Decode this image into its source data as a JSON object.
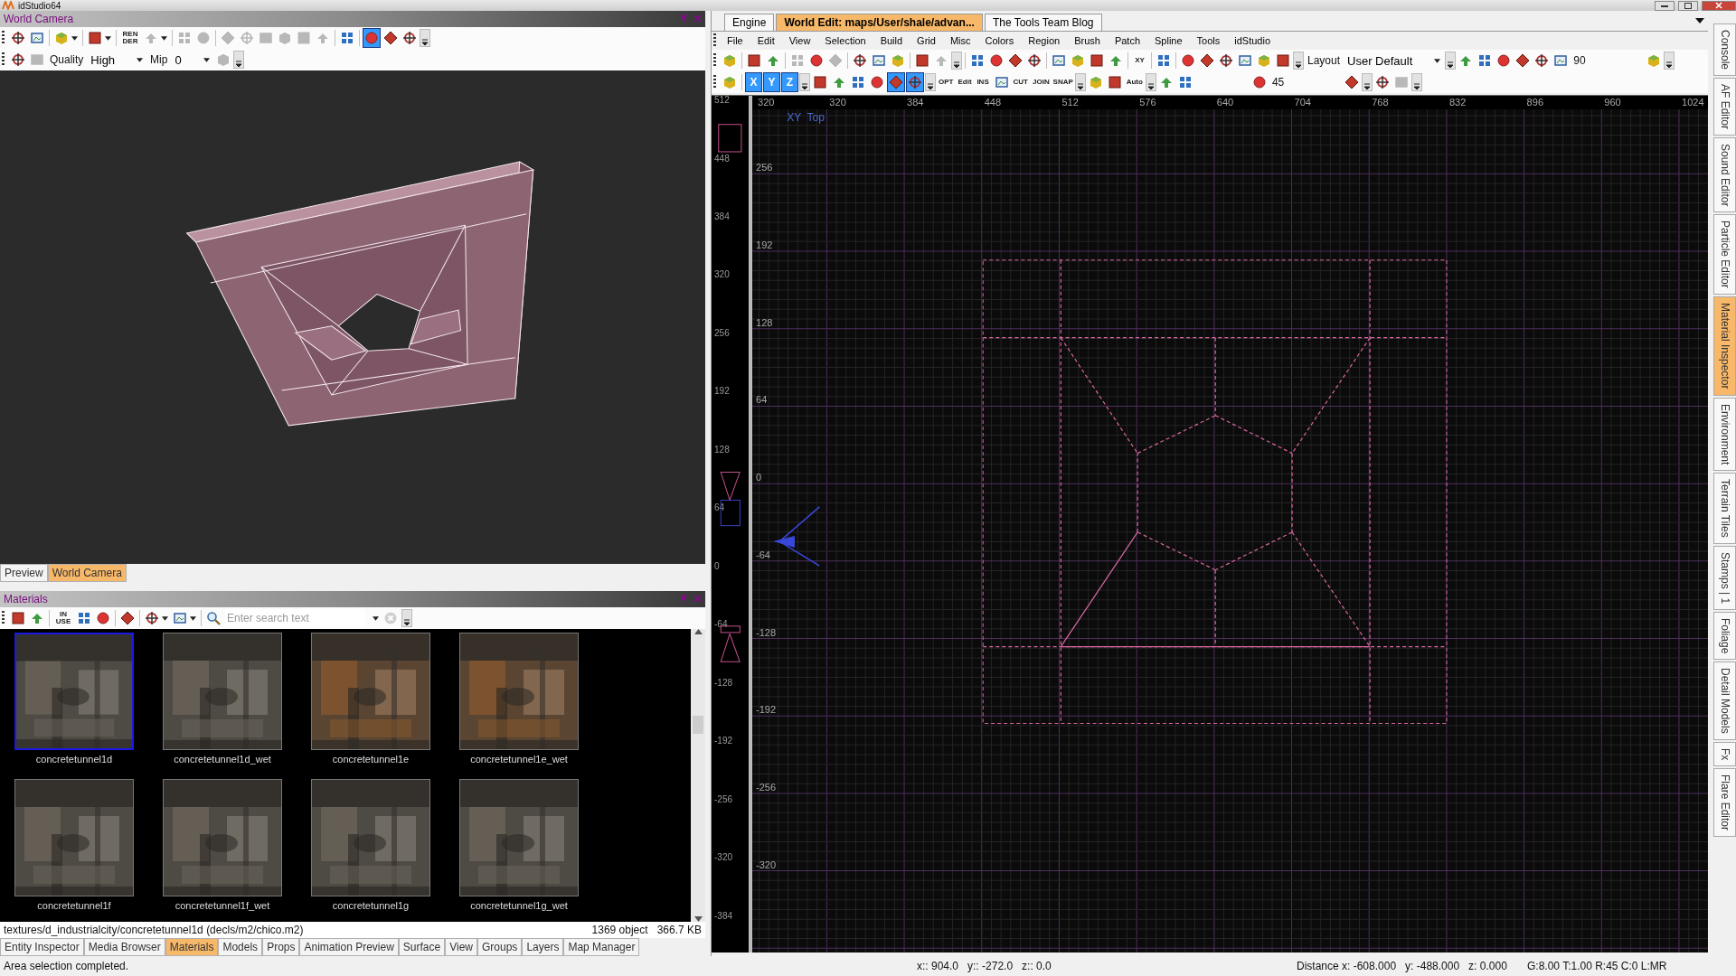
{
  "app_title": "idStudio64",
  "world_camera": {
    "title": "World Camera",
    "toolbar_1": [
      {
        "kind": "icon",
        "selected": false,
        "disabled": false
      },
      {
        "kind": "icon",
        "selected": false,
        "disabled": false
      },
      {
        "kind": "separator"
      },
      {
        "kind": "menu-icon",
        "selected": false,
        "disabled": false
      },
      {
        "kind": "separator"
      },
      {
        "kind": "menu-icon",
        "selected": false,
        "disabled": false
      },
      {
        "kind": "separator"
      },
      {
        "kind": "label-icon",
        "label": "REN DER",
        "selected": false,
        "disabled": false
      },
      {
        "kind": "menu-icon",
        "selected": false,
        "disabled": true
      },
      {
        "kind": "separator"
      },
      {
        "kind": "icon",
        "selected": false,
        "disabled": true
      },
      {
        "kind": "icon",
        "selected": false,
        "disabled": true
      },
      {
        "kind": "separator"
      },
      {
        "kind": "icon",
        "selected": false,
        "disabled": true
      },
      {
        "kind": "icon",
        "selected": false,
        "disabled": true
      },
      {
        "kind": "icon",
        "selected": false,
        "disabled": true
      },
      {
        "kind": "icon",
        "selected": false,
        "disabled": true
      },
      {
        "kind": "icon",
        "selected": false,
        "disabled": true
      },
      {
        "kind": "icon",
        "selected": false,
        "disabled": true
      },
      {
        "kind": "separator"
      },
      {
        "kind": "icon",
        "selected": false,
        "disabled": false
      },
      {
        "kind": "separator"
      },
      {
        "kind": "icon",
        "selected": true,
        "disabled": false
      },
      {
        "kind": "icon",
        "selected": false,
        "disabled": false
      },
      {
        "kind": "icon",
        "selected": false,
        "disabled": false
      },
      {
        "kind": "overflow"
      }
    ],
    "toolbar_2": [
      {
        "kind": "icon",
        "selected": false,
        "disabled": false
      },
      {
        "kind": "icon",
        "selected": false,
        "disabled": true
      },
      {
        "kind": "text",
        "label": "Quality"
      },
      {
        "kind": "dropdown",
        "value": "High"
      },
      {
        "kind": "text",
        "label": "Mip"
      },
      {
        "kind": "dropdown",
        "value": "0"
      },
      {
        "kind": "icon",
        "selected": false,
        "disabled": true
      },
      {
        "kind": "overflow"
      }
    ],
    "tabs": [
      {
        "label": "Preview",
        "selected": false
      },
      {
        "label": "World Camera",
        "selected": true
      }
    ]
  },
  "materials": {
    "title": "Materials",
    "toolbar": [
      {
        "kind": "icon",
        "selected": false,
        "disabled": false
      },
      {
        "kind": "icon",
        "selected": false,
        "disabled": false
      },
      {
        "kind": "separator"
      },
      {
        "kind": "label-icon",
        "label": "IN USE",
        "selected": false,
        "disabled": false
      },
      {
        "kind": "icon",
        "selected": false,
        "disabled": false
      },
      {
        "kind": "icon",
        "selected": false,
        "disabled": false
      },
      {
        "kind": "separator"
      },
      {
        "kind": "icon",
        "selected": false,
        "disabled": false
      },
      {
        "kind": "separator"
      },
      {
        "kind": "menu-icon",
        "selected": false,
        "disabled": false
      },
      {
        "kind": "menu-icon",
        "selected": false,
        "disabled": false
      },
      {
        "kind": "separator"
      },
      {
        "kind": "search",
        "placeholder": "Enter search text"
      },
      {
        "kind": "overflow"
      }
    ],
    "items": [
      {
        "name": "concretetunnel1d",
        "selected": true
      },
      {
        "name": "concretetunnel1d_wet",
        "selected": false
      },
      {
        "name": "concretetunnel1e",
        "selected": false
      },
      {
        "name": "concretetunnel1e_wet",
        "selected": false
      },
      {
        "name": "concretetunnel1f",
        "selected": false
      },
      {
        "name": "concretetunnel1f_wet",
        "selected": false
      },
      {
        "name": "concretetunnel1g",
        "selected": false
      },
      {
        "name": "concretetunnel1g_wet",
        "selected": false
      }
    ],
    "path": "textures/d_industrialcity/concretetunnel1d  (decls/m2/chico.m2)",
    "object_count": "1369 object",
    "size": "366.7 KB"
  },
  "bottom_tabs": [
    {
      "label": "Entity Inspector",
      "selected": false
    },
    {
      "label": "Media Browser",
      "selected": false
    },
    {
      "label": "Materials",
      "selected": true
    },
    {
      "label": "Models",
      "selected": false
    },
    {
      "label": "Props",
      "selected": false
    },
    {
      "label": "Animation Preview",
      "selected": false
    },
    {
      "label": "Surface",
      "selected": false
    },
    {
      "label": "View",
      "selected": false
    },
    {
      "label": "Groups",
      "selected": false
    },
    {
      "label": "Layers",
      "selected": false
    },
    {
      "label": "Map Manager",
      "selected": false
    }
  ],
  "editor": {
    "tabs": [
      {
        "label": "Engine",
        "selected": false
      },
      {
        "label": "World Edit: maps/User/shale/advan...",
        "selected": true
      },
      {
        "label": "The Tools Team Blog",
        "selected": false
      }
    ],
    "menu": [
      "File",
      "Edit",
      "View",
      "Selection",
      "Build",
      "Grid",
      "Misc",
      "Colors",
      "Region",
      "Brush",
      "Patch",
      "Spline",
      "Tools",
      "idStudio"
    ],
    "toolbar_1": [
      {
        "kind": "icon",
        "selected": false,
        "disabled": false
      },
      {
        "kind": "separator"
      },
      {
        "kind": "icon",
        "selected": false,
        "disabled": false
      },
      {
        "kind": "icon",
        "selected": false,
        "disabled": false
      },
      {
        "kind": "separator"
      },
      {
        "kind": "icon",
        "selected": false,
        "disabled": true
      },
      {
        "kind": "icon",
        "selected": false,
        "disabled": false
      },
      {
        "kind": "icon",
        "selected": false,
        "disabled": true
      },
      {
        "kind": "separator"
      },
      {
        "kind": "icon",
        "selected": false,
        "disabled": false
      },
      {
        "kind": "icon",
        "selected": false,
        "disabled": false
      },
      {
        "kind": "icon",
        "selected": false,
        "disabled": false
      },
      {
        "kind": "separator"
      },
      {
        "kind": "icon",
        "selected": false,
        "disabled": false
      },
      {
        "kind": "icon",
        "selected": false,
        "disabled": true
      },
      {
        "kind": "overflow"
      },
      {
        "kind": "separator"
      },
      {
        "kind": "icon",
        "selected": false,
        "disabled": false
      },
      {
        "kind": "icon",
        "selected": false,
        "disabled": false
      },
      {
        "kind": "icon",
        "selected": false,
        "disabled": false
      },
      {
        "kind": "icon",
        "selected": false,
        "disabled": false
      },
      {
        "kind": "separator"
      },
      {
        "kind": "icon",
        "selected": false,
        "disabled": false
      },
      {
        "kind": "icon",
        "selected": false,
        "disabled": false
      },
      {
        "kind": "icon",
        "selected": false,
        "disabled": false
      },
      {
        "kind": "icon",
        "selected": false,
        "disabled": false
      },
      {
        "kind": "separator"
      },
      {
        "kind": "label-icon",
        "label": "XY",
        "selected": false,
        "disabled": false
      },
      {
        "kind": "separator"
      },
      {
        "kind": "icon",
        "selected": false,
        "disabled": false
      },
      {
        "kind": "separator"
      },
      {
        "kind": "icon",
        "selected": false,
        "disabled": false
      },
      {
        "kind": "icon",
        "selected": false,
        "disabled": false
      },
      {
        "kind": "icon",
        "selected": false,
        "disabled": false
      },
      {
        "kind": "icon",
        "selected": false,
        "disabled": false
      },
      {
        "kind": "icon",
        "selected": false,
        "disabled": false
      },
      {
        "kind": "icon",
        "selected": false,
        "disabled": false
      },
      {
        "kind": "overflow"
      },
      {
        "kind": "text",
        "label": "Layout"
      },
      {
        "kind": "dropdown",
        "value": "User Default"
      },
      {
        "kind": "overflow"
      },
      {
        "kind": "icon",
        "selected": false,
        "disabled": false
      },
      {
        "kind": "icon",
        "selected": false,
        "disabled": false
      },
      {
        "kind": "icon",
        "selected": false,
        "disabled": false
      },
      {
        "kind": "icon",
        "selected": false,
        "disabled": false
      },
      {
        "kind": "icon",
        "selected": false,
        "disabled": false
      },
      {
        "kind": "icon",
        "selected": false,
        "disabled": false
      },
      {
        "kind": "text",
        "label": "90"
      },
      {
        "kind": "gap"
      },
      {
        "kind": "icon",
        "selected": false,
        "disabled": false
      },
      {
        "kind": "overflow"
      }
    ],
    "toolbar_2": [
      {
        "kind": "icon",
        "selected": false,
        "disabled": false
      },
      {
        "kind": "separator"
      },
      {
        "kind": "label-icon",
        "label": "X",
        "selected": true,
        "disabled": false
      },
      {
        "kind": "label-icon",
        "label": "Y",
        "selected": true,
        "disabled": false
      },
      {
        "kind": "label-icon",
        "label": "Z",
        "selected": true,
        "disabled": false
      },
      {
        "kind": "overflow"
      },
      {
        "kind": "icon",
        "selected": false,
        "disabled": false
      },
      {
        "kind": "icon",
        "selected": false,
        "disabled": false
      },
      {
        "kind": "icon",
        "selected": false,
        "disabled": false
      },
      {
        "kind": "icon",
        "selected": false,
        "disabled": false
      },
      {
        "kind": "icon",
        "selected": true,
        "disabled": false
      },
      {
        "kind": "icon",
        "selected": true,
        "disabled": false
      },
      {
        "kind": "overflow"
      },
      {
        "kind": "label-icon",
        "label": "OPT",
        "selected": false,
        "disabled": false
      },
      {
        "kind": "label-icon",
        "label": "Edit",
        "selected": false,
        "disabled": false
      },
      {
        "kind": "label-icon",
        "label": "INS",
        "selected": false,
        "disabled": false
      },
      {
        "kind": "icon",
        "selected": false,
        "disabled": false
      },
      {
        "kind": "label-icon",
        "label": "CUT",
        "selected": false,
        "disabled": false
      },
      {
        "kind": "label-icon",
        "label": "JOIN",
        "selected": false,
        "disabled": false
      },
      {
        "kind": "label-icon",
        "label": "SNAP",
        "selected": false,
        "disabled": false
      },
      {
        "kind": "overflow"
      },
      {
        "kind": "icon",
        "selected": false,
        "disabled": false
      },
      {
        "kind": "icon",
        "selected": false,
        "disabled": false
      },
      {
        "kind": "label-icon",
        "label": "Auto",
        "selected": false,
        "disabled": false
      },
      {
        "kind": "overflow"
      },
      {
        "kind": "icon",
        "selected": false,
        "disabled": false
      },
      {
        "kind": "icon",
        "selected": false,
        "disabled": false
      },
      {
        "kind": "gap"
      },
      {
        "kind": "icon",
        "selected": false,
        "disabled": false
      },
      {
        "kind": "text",
        "label": "45"
      },
      {
        "kind": "gap"
      },
      {
        "kind": "icon",
        "selected": false,
        "disabled": false
      },
      {
        "kind": "overflow"
      },
      {
        "kind": "icon",
        "selected": false,
        "disabled": false
      },
      {
        "kind": "icon",
        "selected": false,
        "disabled": true
      },
      {
        "kind": "overflow"
      }
    ],
    "view_label": "XY  Top",
    "top_ruler": [
      "320",
      "320",
      "384",
      "448",
      "512",
      "576",
      "640",
      "704",
      "768",
      "832",
      "896",
      "960",
      "1024"
    ],
    "side_ruler": [
      "256",
      "192",
      "128",
      "64",
      "0",
      "-64",
      "-128",
      "-192",
      "-256",
      "-320"
    ],
    "z_ruler": [
      "512",
      "448",
      "384",
      "320",
      "256",
      "192",
      "128",
      "64",
      "0",
      "-64",
      "-128",
      "-192",
      "-256",
      "-320",
      "-384"
    ]
  },
  "side_tabs": [
    {
      "label": "Console",
      "selected": false
    },
    {
      "label": "AF Editor",
      "selected": false
    },
    {
      "label": "Sound Editor",
      "selected": false
    },
    {
      "label": "Particle Editor",
      "selected": false
    },
    {
      "label": "Material Inspector",
      "selected": true
    },
    {
      "label": "Environment",
      "selected": false
    },
    {
      "label": "Terrain Tiles",
      "selected": false
    },
    {
      "label": "Stamps | 1",
      "selected": false
    },
    {
      "label": "Foliage",
      "selected": false
    },
    {
      "label": "Detail Models",
      "selected": false
    },
    {
      "label": "Fx",
      "selected": false
    },
    {
      "label": "Flare Editor",
      "selected": false
    }
  ],
  "status_bar": {
    "message": "Area selection completed.",
    "coords": [
      "x:: 904.0",
      "y:: -272.0",
      "z:: 0.0"
    ],
    "distance": [
      "Distance x: -608.000",
      "y: -488.000",
      "z: 0.000"
    ],
    "grid_info": "G:8.00 T:1.00 R:45 C:0 L:MR"
  }
}
